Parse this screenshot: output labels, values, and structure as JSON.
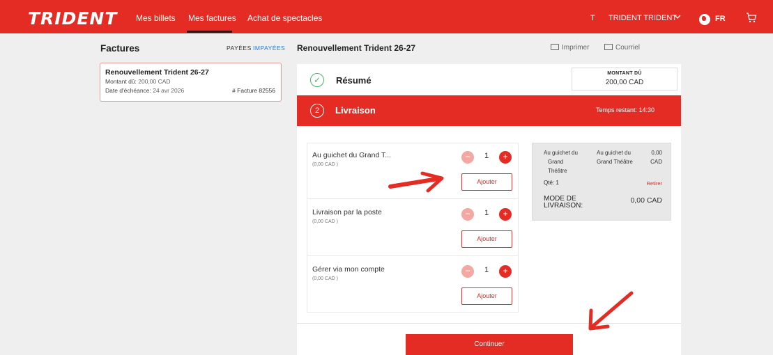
{
  "topbar": {
    "logo": "TRIDENT",
    "nav": [
      "Mes billets",
      "Mes factures",
      "Achat de spectacles"
    ],
    "user_initial": "T",
    "user_name": "TRIDENT TRIDENT",
    "lang": "FR",
    "icons": {
      "chevron": "chevron-down-icon",
      "globe": "globe-icon",
      "cart": "cart-icon"
    }
  },
  "invoices": {
    "title": "Factures",
    "filter_paid": "PAYÉES",
    "filter_unpaid": "IMPAYÉES",
    "card": {
      "title": "Renouvellement Trident 26-27",
      "amount_label": "Montant dû:",
      "amount_value": "200,00 CAD",
      "due_label": "Date d'échéance:",
      "due_value": "24 avr 2026",
      "invoice_number": "# Facture 82556"
    }
  },
  "detail": {
    "title": "Renouvellement Trident 26-27",
    "print": "Imprimer",
    "email": "Courriel",
    "resume": "Résumé",
    "montant_label": "MONTANT DÛ",
    "montant_value": "200,00 CAD",
    "step_number": "2",
    "step_title": "Livraison",
    "time_left": "Temps restant: 14:30"
  },
  "options": [
    {
      "name": "Au guichet du Grand T...",
      "price": "(0,00 CAD )",
      "qty": "1",
      "add": "Ajouter"
    },
    {
      "name": "Livraison par la poste",
      "price": "(0,00 CAD )",
      "qty": "1",
      "add": "Ajouter"
    },
    {
      "name": "Gérer via mon compte",
      "price": "(0,00 CAD )",
      "qty": "1",
      "add": "Ajouter"
    }
  ],
  "summary": {
    "item_col1": [
      "Au guichet du",
      "Grand",
      "Théâtre"
    ],
    "item_col2": [
      "Au guichet du",
      "Grand Théâtre"
    ],
    "item_col3": [
      "0,00",
      "CAD"
    ],
    "qty": "Qté: 1",
    "remove": "Retirer",
    "mode_label": "MODE DE LIVRAISON:",
    "mode_value": "0,00 CAD"
  },
  "continue": "Continuer",
  "colors": {
    "accent": "#e42b24",
    "link": "#1e7ad6",
    "success": "#4bb26b"
  }
}
